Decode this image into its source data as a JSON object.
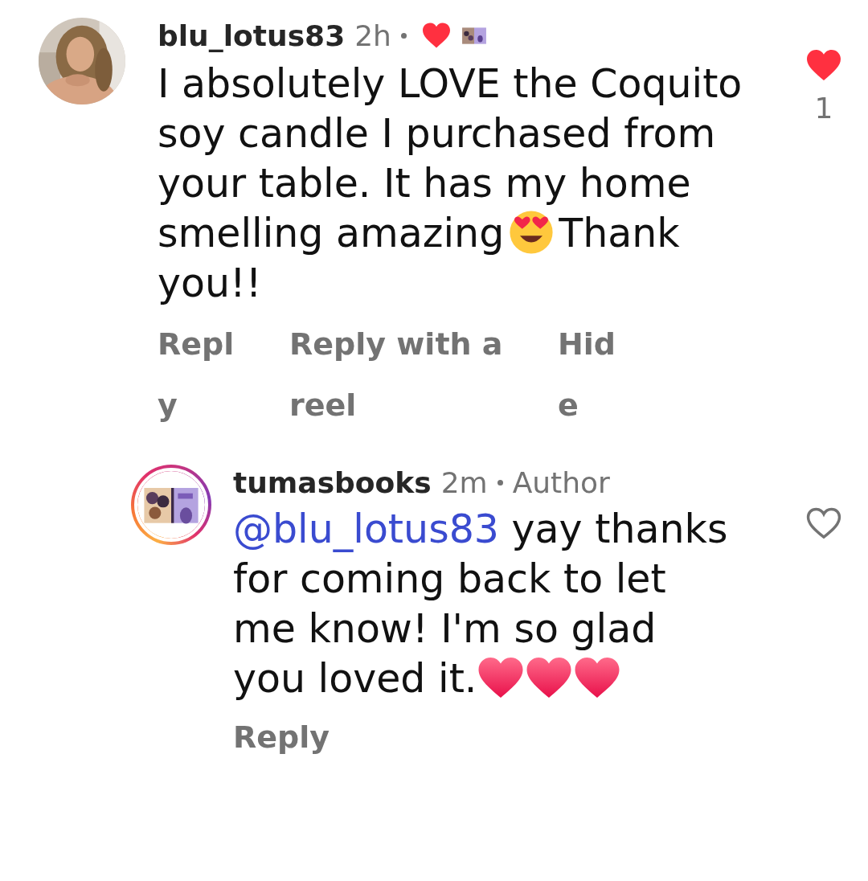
{
  "comments": [
    {
      "username": "blu_lotus83",
      "time": "2h",
      "liked_by_author": true,
      "sticker": true,
      "body": [
        {
          "kind": "text",
          "text": "I absolutely LOVE the Coquito soy candle I purchased from your table. It has my home smelling amazing"
        },
        {
          "kind": "heart_eyes_emoji"
        },
        {
          "kind": "text",
          "text": "Thank you!!"
        }
      ],
      "actions": [
        "Reply",
        "Reply with a reel",
        "Hide"
      ],
      "liked": true,
      "like_count": "1",
      "replies": [
        {
          "avatar": {
            "kind": "book",
            "story_ring": true
          },
          "username": "tumasbooks",
          "time": "2m",
          "author_label": "Author",
          "liked_by_author": false,
          "sticker": false,
          "body": [
            {
              "kind": "mention",
              "text": "@blu_lotus83"
            },
            {
              "kind": "text",
              "text": "yay thanks for coming back to let me know! I'm so glad you loved it."
            },
            {
              "kind": "heart_emoji"
            },
            {
              "kind": "heart_emoji"
            },
            {
              "kind": "heart_emoji"
            }
          ],
          "actions": [
            "Reply"
          ],
          "liked": false
        }
      ]
    }
  ]
}
